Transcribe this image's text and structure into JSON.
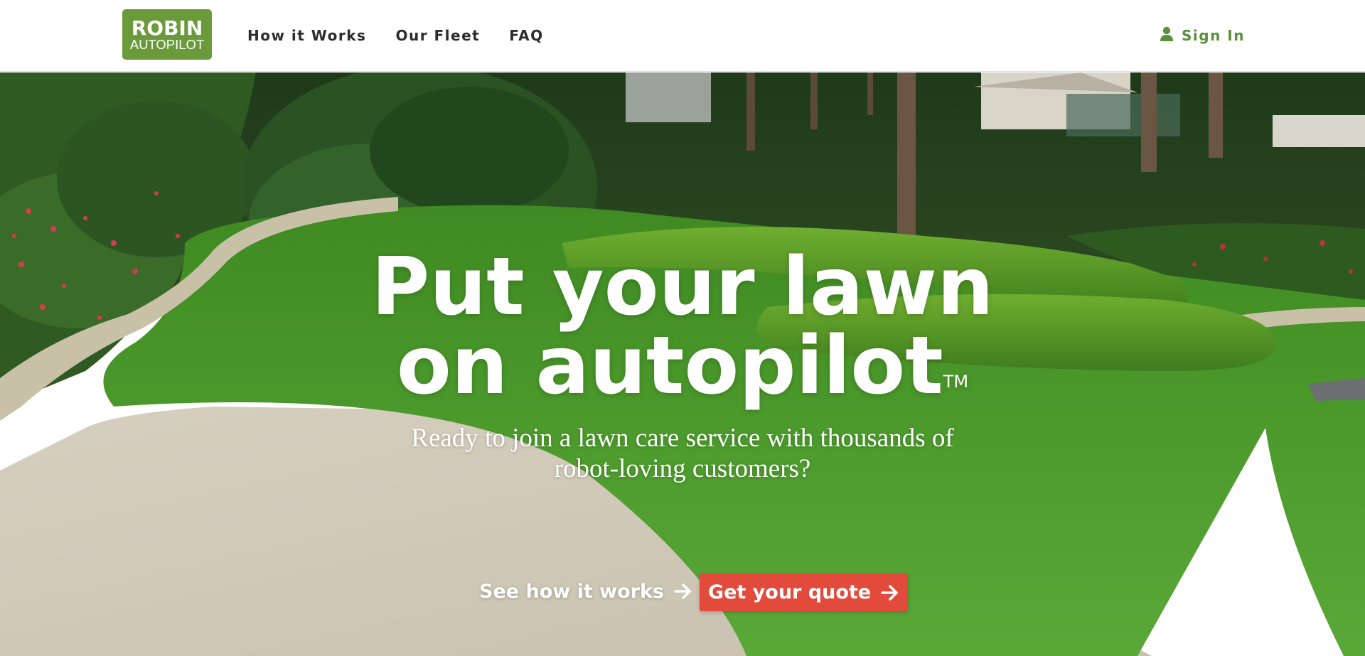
{
  "header": {
    "logo": {
      "line1": "ROBIN",
      "line2": "AUTOPILOT"
    },
    "nav": [
      {
        "label": "How it Works"
      },
      {
        "label": "Our Fleet"
      },
      {
        "label": "FAQ"
      }
    ],
    "sign_in": {
      "label": "Sign In",
      "icon": "user-icon"
    }
  },
  "hero": {
    "headline_line1": "Put your lawn",
    "headline_line2": "on autopilot",
    "trademark": "TM",
    "subhead": "Ready to join a lawn care service with thousands of robot-loving customers?",
    "secondary_cta": {
      "label": "See how it works",
      "icon": "arrow-right-icon"
    },
    "primary_cta": {
      "label": "Get your quote",
      "icon": "arrow-right-icon"
    }
  },
  "colors": {
    "brand_green": "#6a9a3a",
    "nav_text": "#2c2c2c",
    "signin_green": "#5a8f3b",
    "cta_red": "#e24a3b",
    "lawn_green": "#4e9a2c"
  }
}
